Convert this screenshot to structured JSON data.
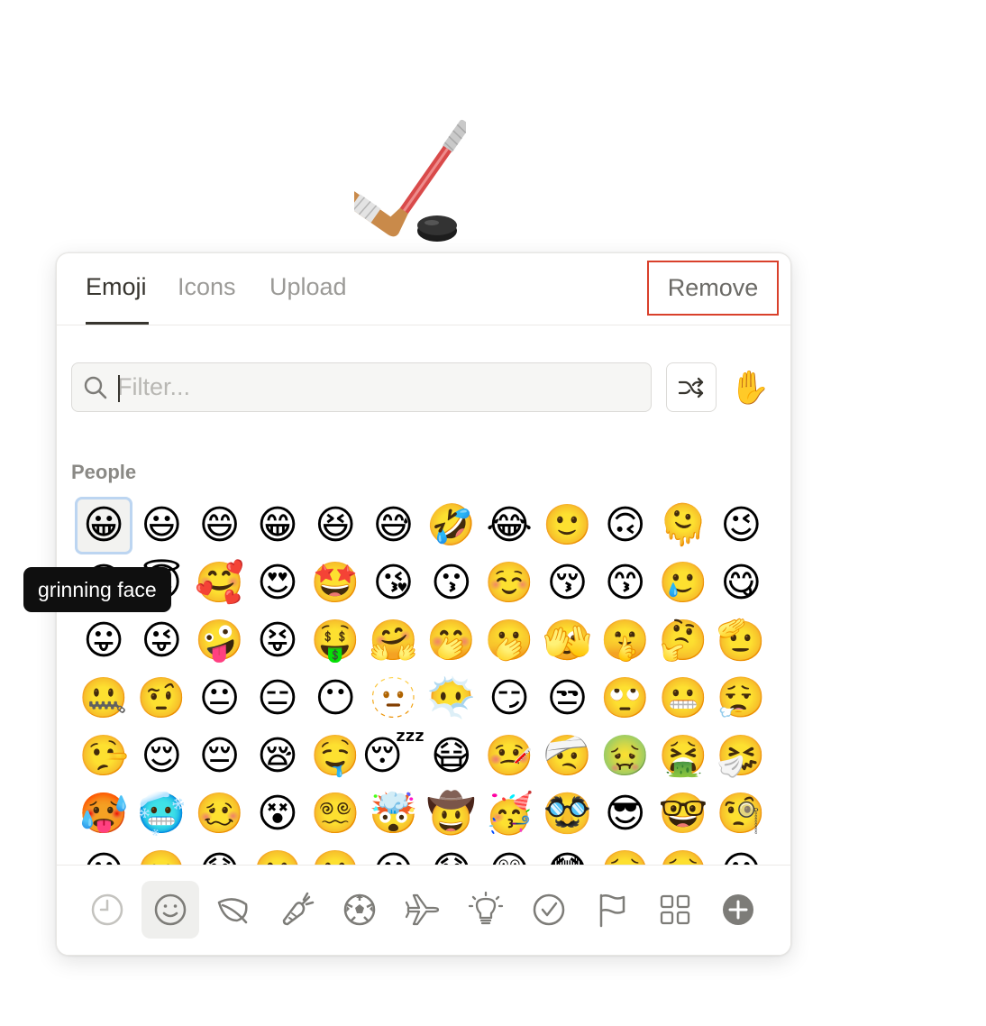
{
  "page_icon": {
    "name": "ice hockey",
    "glyph": "🏒"
  },
  "tabs": [
    {
      "label": "Emoji",
      "active": true
    },
    {
      "label": "Icons",
      "active": false
    },
    {
      "label": "Upload",
      "active": false
    }
  ],
  "remove_label": "Remove",
  "search": {
    "placeholder": "Filter...",
    "value": ""
  },
  "skin_tone_glyph": "✋",
  "section_title": "People",
  "tooltip": "grinning face",
  "emojis": [
    "😀",
    "😃",
    "😄",
    "😁",
    "😆",
    "😅",
    "🤣",
    "😂",
    "🙂",
    "🙃",
    "🫠",
    "😉",
    "😊",
    "😇",
    "🥰",
    "😍",
    "🤩",
    "😘",
    "😗",
    "☺️",
    "😚",
    "😙",
    "🥲",
    "😋",
    "😛",
    "😜",
    "🤪",
    "😝",
    "🤑",
    "🤗",
    "🤭",
    "🫢",
    "🫣",
    "🤫",
    "🤔",
    "🫡",
    "🤐",
    "🤨",
    "😐",
    "😑",
    "😶",
    "🫥",
    "😶‍🌫️",
    "😏",
    "😒",
    "🙄",
    "😬",
    "😮‍💨",
    "🤥",
    "😌",
    "😔",
    "😪",
    "🤤",
    "😴",
    "😷",
    "🤒",
    "🤕",
    "🤢",
    "🤮",
    "🤧",
    "🥵",
    "🥶",
    "🥴",
    "😵",
    "😵‍💫",
    "🤯",
    "🤠",
    "🥳",
    "🥸",
    "😎",
    "🤓",
    "🧐",
    "😕",
    "🫤",
    "😟",
    "🙁",
    "☹️",
    "😮",
    "😯",
    "😲",
    "😳",
    "🥺",
    "🥹",
    "😦"
  ],
  "categories": [
    {
      "name": "recent-icon",
      "active": false
    },
    {
      "name": "smiley-icon",
      "active": true
    },
    {
      "name": "leaf-icon",
      "active": false
    },
    {
      "name": "carrot-icon",
      "active": false
    },
    {
      "name": "soccer-ball-icon",
      "active": false
    },
    {
      "name": "airplane-icon",
      "active": false
    },
    {
      "name": "lightbulb-icon",
      "active": false
    },
    {
      "name": "checkmark-icon",
      "active": false
    },
    {
      "name": "flag-icon",
      "active": false
    },
    {
      "name": "grid-icon",
      "active": false
    },
    {
      "name": "add-icon",
      "active": false
    }
  ],
  "colors": {
    "accent_selected": "#bcd5f1",
    "remove_highlight": "#d9402b",
    "text_primary": "#37352f",
    "text_muted": "#9b9a97"
  }
}
